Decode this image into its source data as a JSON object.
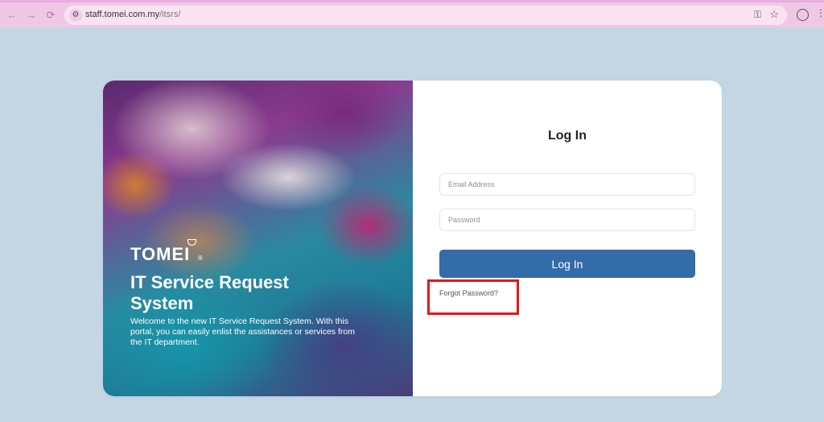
{
  "browser": {
    "url_domain": "staff.tomei.com.my",
    "url_path": "/itsrs/",
    "back": "←",
    "forward": "→",
    "reload": "⟳",
    "site_info": "⚙",
    "key": "⚿",
    "star": "☆",
    "menu": "⋮"
  },
  "hero": {
    "brand": "TOMEI",
    "brand_reg": "®",
    "title": "IT Service Request System",
    "description": "Welcome to the new IT Service Request System. With this portal, you can easily enlist the assistances or services from the IT department."
  },
  "login": {
    "title": "Log In",
    "email_placeholder": "Email Address",
    "password_placeholder": "Password",
    "button_label": "Log In",
    "forgot_label": "Forgot Password?"
  },
  "colors": {
    "page_bg": "#c4d5e4",
    "primary_button": "#336ca9",
    "highlight_border": "#e0191b",
    "browser_chrome": "#f0c8e6"
  }
}
